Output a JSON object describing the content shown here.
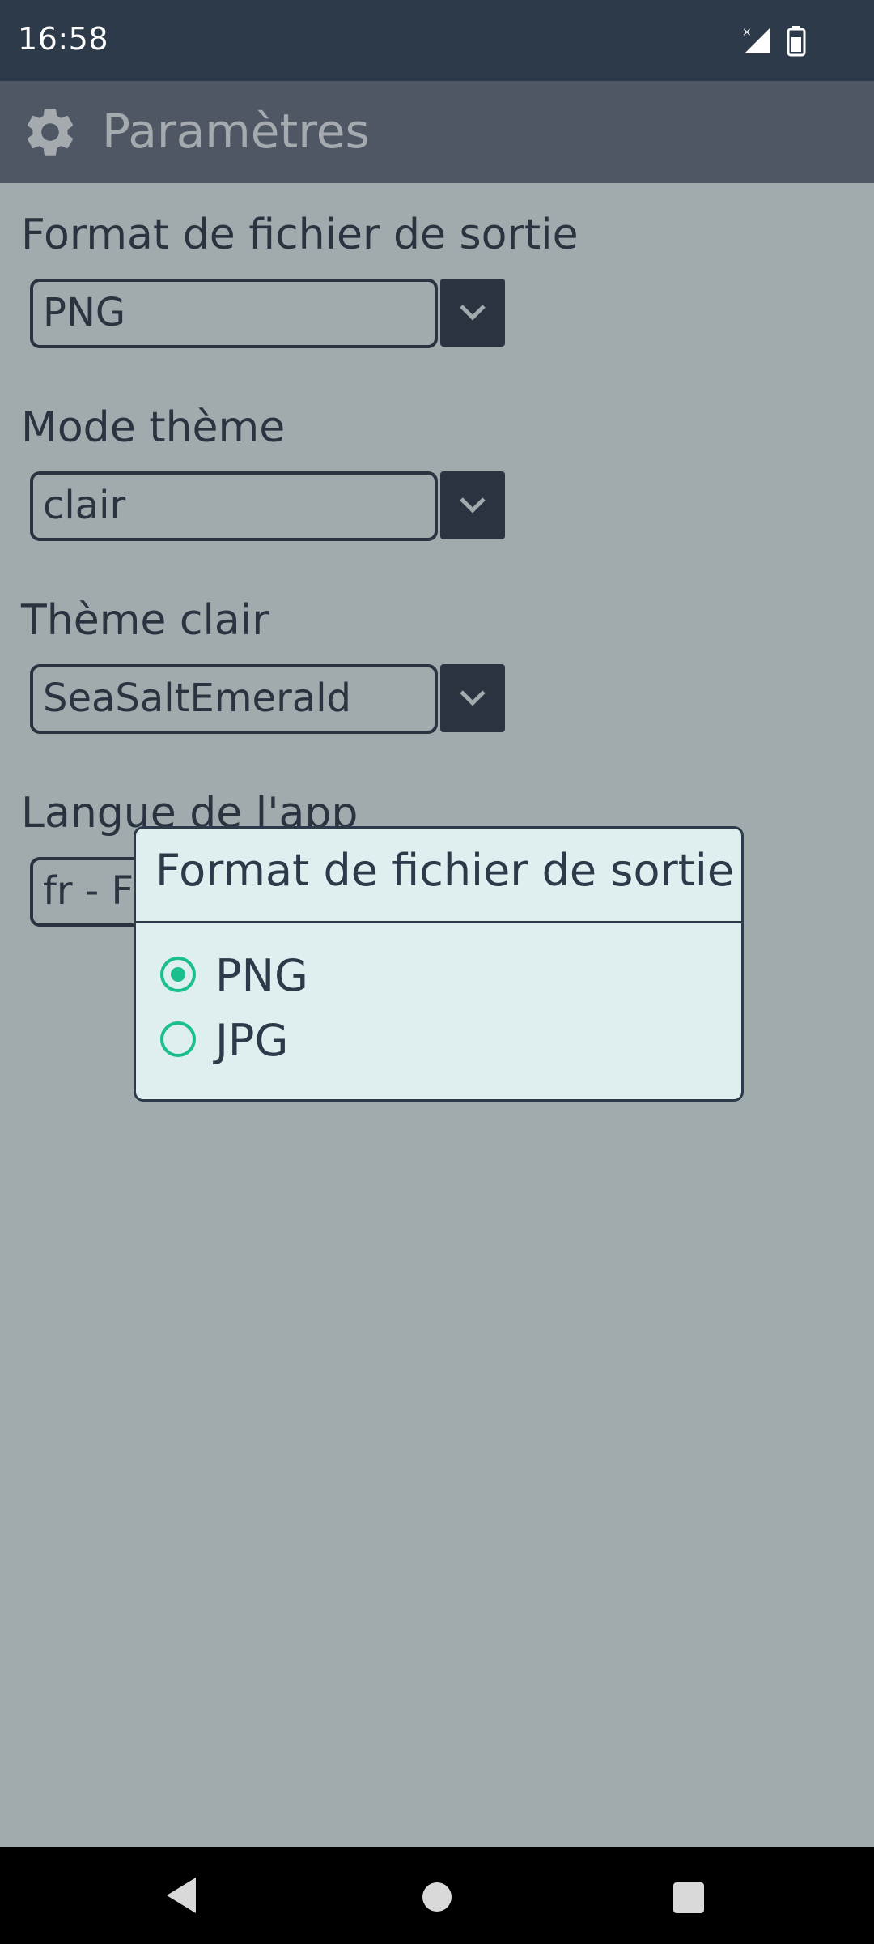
{
  "status_bar": {
    "time": "16:58",
    "icons": [
      "signal-icon",
      "battery-icon"
    ]
  },
  "app_bar": {
    "title": "Paramètres",
    "icon": "gear-icon"
  },
  "settings": [
    {
      "label": "Format de fichier de sortie",
      "value": "PNG"
    },
    {
      "label": "Mode thème",
      "value": "clair"
    },
    {
      "label": "Thème clair",
      "value": "SeaSaltEmerald"
    },
    {
      "label": "Langue de l'app",
      "value": "fr - Fr"
    }
  ],
  "dialog": {
    "title": "Format de fichier de sortie",
    "options": [
      {
        "label": "PNG",
        "selected": true
      },
      {
        "label": "JPG",
        "selected": false
      }
    ]
  },
  "nav_bar": {
    "icons": [
      "back-icon",
      "home-icon",
      "recents-icon"
    ]
  },
  "colors": {
    "primary_dark": "#2d3a4a",
    "accent": "#1bbf8b",
    "background": "#dfeeef",
    "app_bar": "#647081"
  }
}
